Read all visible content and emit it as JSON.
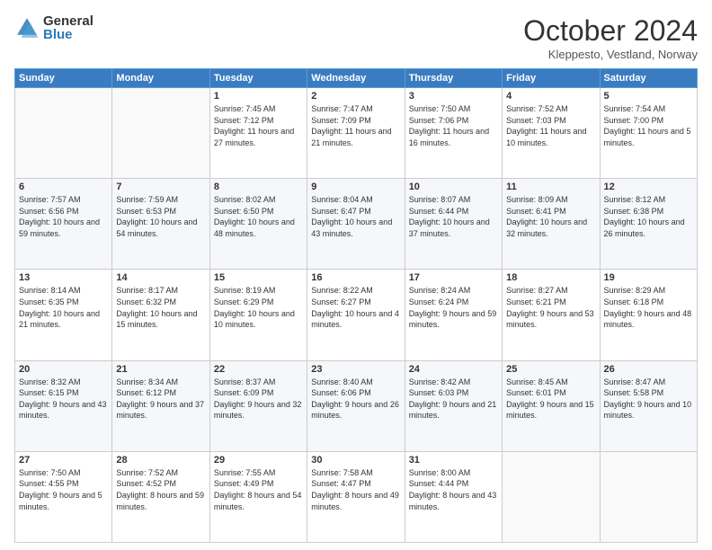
{
  "header": {
    "logo_general": "General",
    "logo_blue": "Blue",
    "month_title": "October 2024",
    "subtitle": "Kleppesto, Vestland, Norway"
  },
  "days_of_week": [
    "Sunday",
    "Monday",
    "Tuesday",
    "Wednesday",
    "Thursday",
    "Friday",
    "Saturday"
  ],
  "weeks": [
    [
      {
        "day": "",
        "info": ""
      },
      {
        "day": "",
        "info": ""
      },
      {
        "day": "1",
        "info": "Sunrise: 7:45 AM\nSunset: 7:12 PM\nDaylight: 11 hours and 27 minutes."
      },
      {
        "day": "2",
        "info": "Sunrise: 7:47 AM\nSunset: 7:09 PM\nDaylight: 11 hours and 21 minutes."
      },
      {
        "day": "3",
        "info": "Sunrise: 7:50 AM\nSunset: 7:06 PM\nDaylight: 11 hours and 16 minutes."
      },
      {
        "day": "4",
        "info": "Sunrise: 7:52 AM\nSunset: 7:03 PM\nDaylight: 11 hours and 10 minutes."
      },
      {
        "day": "5",
        "info": "Sunrise: 7:54 AM\nSunset: 7:00 PM\nDaylight: 11 hours and 5 minutes."
      }
    ],
    [
      {
        "day": "6",
        "info": "Sunrise: 7:57 AM\nSunset: 6:56 PM\nDaylight: 10 hours and 59 minutes."
      },
      {
        "day": "7",
        "info": "Sunrise: 7:59 AM\nSunset: 6:53 PM\nDaylight: 10 hours and 54 minutes."
      },
      {
        "day": "8",
        "info": "Sunrise: 8:02 AM\nSunset: 6:50 PM\nDaylight: 10 hours and 48 minutes."
      },
      {
        "day": "9",
        "info": "Sunrise: 8:04 AM\nSunset: 6:47 PM\nDaylight: 10 hours and 43 minutes."
      },
      {
        "day": "10",
        "info": "Sunrise: 8:07 AM\nSunset: 6:44 PM\nDaylight: 10 hours and 37 minutes."
      },
      {
        "day": "11",
        "info": "Sunrise: 8:09 AM\nSunset: 6:41 PM\nDaylight: 10 hours and 32 minutes."
      },
      {
        "day": "12",
        "info": "Sunrise: 8:12 AM\nSunset: 6:38 PM\nDaylight: 10 hours and 26 minutes."
      }
    ],
    [
      {
        "day": "13",
        "info": "Sunrise: 8:14 AM\nSunset: 6:35 PM\nDaylight: 10 hours and 21 minutes."
      },
      {
        "day": "14",
        "info": "Sunrise: 8:17 AM\nSunset: 6:32 PM\nDaylight: 10 hours and 15 minutes."
      },
      {
        "day": "15",
        "info": "Sunrise: 8:19 AM\nSunset: 6:29 PM\nDaylight: 10 hours and 10 minutes."
      },
      {
        "day": "16",
        "info": "Sunrise: 8:22 AM\nSunset: 6:27 PM\nDaylight: 10 hours and 4 minutes."
      },
      {
        "day": "17",
        "info": "Sunrise: 8:24 AM\nSunset: 6:24 PM\nDaylight: 9 hours and 59 minutes."
      },
      {
        "day": "18",
        "info": "Sunrise: 8:27 AM\nSunset: 6:21 PM\nDaylight: 9 hours and 53 minutes."
      },
      {
        "day": "19",
        "info": "Sunrise: 8:29 AM\nSunset: 6:18 PM\nDaylight: 9 hours and 48 minutes."
      }
    ],
    [
      {
        "day": "20",
        "info": "Sunrise: 8:32 AM\nSunset: 6:15 PM\nDaylight: 9 hours and 43 minutes."
      },
      {
        "day": "21",
        "info": "Sunrise: 8:34 AM\nSunset: 6:12 PM\nDaylight: 9 hours and 37 minutes."
      },
      {
        "day": "22",
        "info": "Sunrise: 8:37 AM\nSunset: 6:09 PM\nDaylight: 9 hours and 32 minutes."
      },
      {
        "day": "23",
        "info": "Sunrise: 8:40 AM\nSunset: 6:06 PM\nDaylight: 9 hours and 26 minutes."
      },
      {
        "day": "24",
        "info": "Sunrise: 8:42 AM\nSunset: 6:03 PM\nDaylight: 9 hours and 21 minutes."
      },
      {
        "day": "25",
        "info": "Sunrise: 8:45 AM\nSunset: 6:01 PM\nDaylight: 9 hours and 15 minutes."
      },
      {
        "day": "26",
        "info": "Sunrise: 8:47 AM\nSunset: 5:58 PM\nDaylight: 9 hours and 10 minutes."
      }
    ],
    [
      {
        "day": "27",
        "info": "Sunrise: 7:50 AM\nSunset: 4:55 PM\nDaylight: 9 hours and 5 minutes."
      },
      {
        "day": "28",
        "info": "Sunrise: 7:52 AM\nSunset: 4:52 PM\nDaylight: 8 hours and 59 minutes."
      },
      {
        "day": "29",
        "info": "Sunrise: 7:55 AM\nSunset: 4:49 PM\nDaylight: 8 hours and 54 minutes."
      },
      {
        "day": "30",
        "info": "Sunrise: 7:58 AM\nSunset: 4:47 PM\nDaylight: 8 hours and 49 minutes."
      },
      {
        "day": "31",
        "info": "Sunrise: 8:00 AM\nSunset: 4:44 PM\nDaylight: 8 hours and 43 minutes."
      },
      {
        "day": "",
        "info": ""
      },
      {
        "day": "",
        "info": ""
      }
    ]
  ]
}
